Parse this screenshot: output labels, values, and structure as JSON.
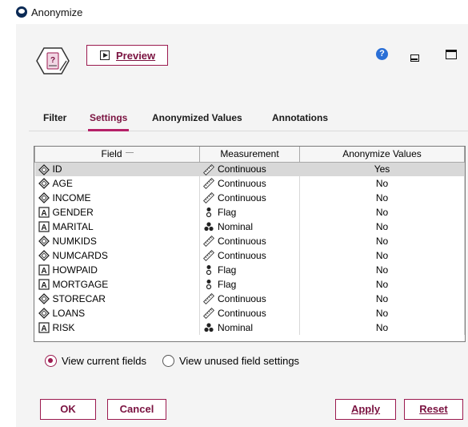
{
  "window": {
    "title": "Anonymize"
  },
  "toolbar": {
    "preview_label": "Preview"
  },
  "tabs": [
    {
      "label": "Filter",
      "active": false
    },
    {
      "label": "Settings",
      "active": true
    },
    {
      "label": "Anonymized Values",
      "active": false
    },
    {
      "label": "Annotations",
      "active": false
    }
  ],
  "table": {
    "headers": {
      "field": "Field",
      "measurement": "Measurement",
      "anonymize": "Anonymize Values"
    },
    "rows": [
      {
        "field": "ID",
        "field_icon": "continuous-diamond-icon",
        "measurement": "Continuous",
        "measurement_icon": "ruler-icon",
        "anonymize": "Yes",
        "selected": true
      },
      {
        "field": "AGE",
        "field_icon": "continuous-diamond-icon",
        "measurement": "Continuous",
        "measurement_icon": "ruler-icon",
        "anonymize": "No"
      },
      {
        "field": "INCOME",
        "field_icon": "continuous-diamond-icon",
        "measurement": "Continuous",
        "measurement_icon": "ruler-icon",
        "anonymize": "No"
      },
      {
        "field": "GENDER",
        "field_icon": "string-a-icon",
        "measurement": "Flag",
        "measurement_icon": "flag-icon",
        "anonymize": "No"
      },
      {
        "field": "MARITAL",
        "field_icon": "string-a-icon",
        "measurement": "Nominal",
        "measurement_icon": "nominal-icon",
        "anonymize": "No"
      },
      {
        "field": "NUMKIDS",
        "field_icon": "continuous-diamond-icon",
        "measurement": "Continuous",
        "measurement_icon": "ruler-icon",
        "anonymize": "No"
      },
      {
        "field": "NUMCARDS",
        "field_icon": "continuous-diamond-icon",
        "measurement": "Continuous",
        "measurement_icon": "ruler-icon",
        "anonymize": "No"
      },
      {
        "field": "HOWPAID",
        "field_icon": "string-a-icon",
        "measurement": "Flag",
        "measurement_icon": "flag-icon",
        "anonymize": "No"
      },
      {
        "field": "MORTGAGE",
        "field_icon": "string-a-icon",
        "measurement": "Flag",
        "measurement_icon": "flag-icon",
        "anonymize": "No"
      },
      {
        "field": "STORECAR",
        "field_icon": "continuous-diamond-icon",
        "measurement": "Continuous",
        "measurement_icon": "ruler-icon",
        "anonymize": "No"
      },
      {
        "field": "LOANS",
        "field_icon": "continuous-diamond-icon",
        "measurement": "Continuous",
        "measurement_icon": "ruler-icon",
        "anonymize": "No"
      },
      {
        "field": "RISK",
        "field_icon": "string-a-icon",
        "measurement": "Nominal",
        "measurement_icon": "nominal-icon",
        "anonymize": "No"
      }
    ]
  },
  "view_options": [
    {
      "label": "View current fields",
      "selected": true
    },
    {
      "label": "View unused field settings",
      "selected": false
    }
  ],
  "buttons": {
    "ok": "OK",
    "cancel": "Cancel",
    "apply": "Apply",
    "reset": "Reset"
  },
  "colors": {
    "accent": "#9b1a4f",
    "accent_text": "#7a1240",
    "selected_row": "#d8d8d8",
    "panel_bg": "#f4f4f4"
  }
}
